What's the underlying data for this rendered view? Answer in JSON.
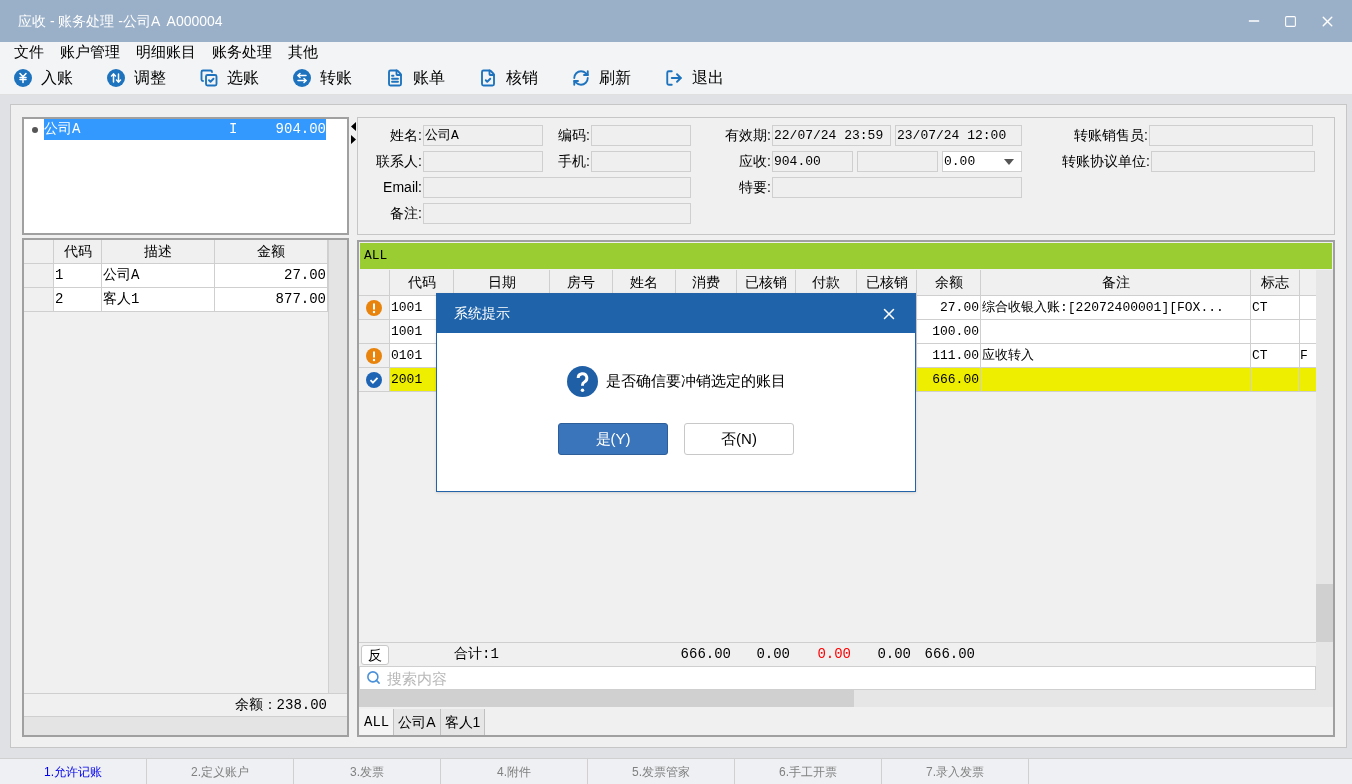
{
  "window": {
    "title": "应收 - 账务处理 -公司A  A000004"
  },
  "menu": [
    "文件",
    "账户管理",
    "明细账目",
    "账务处理",
    "其他"
  ],
  "toolbar": [
    {
      "label": "入账",
      "kind": "yen"
    },
    {
      "label": "调整",
      "kind": "swap-vertical"
    },
    {
      "label": "选账",
      "kind": "select"
    },
    {
      "label": "转账",
      "kind": "transfer"
    },
    {
      "label": "账单",
      "kind": "bill"
    },
    {
      "label": "核销",
      "kind": "verify"
    },
    {
      "label": "刷新",
      "kind": "refresh"
    },
    {
      "label": "退出",
      "kind": "exit"
    }
  ],
  "accounts": [
    {
      "name": "公司A",
      "type": "I",
      "amount": "904.00",
      "selected": true
    }
  ],
  "profile": {
    "name": {
      "label": "姓名:",
      "value": "公司A"
    },
    "code": {
      "label": "编码:"
    },
    "contact": {
      "label": "联系人:"
    },
    "mobile": {
      "label": "手机:"
    },
    "email": {
      "label": "Email:"
    },
    "note": {
      "label": "备注:"
    },
    "validity": {
      "label": "有效期:",
      "from": "22/07/24 23:59",
      "to": "23/07/24 12:00"
    },
    "receivable": {
      "label": "应收:",
      "value": "904.00",
      "rate": "0.00"
    },
    "special": {
      "label": "特要:"
    },
    "salesperson": {
      "label": "转账销售员:"
    },
    "agreement_unit": {
      "label": "转账协议单位:"
    }
  },
  "left_grid": {
    "columns": [
      "代码",
      "描述",
      "金额"
    ],
    "rows": [
      {
        "code": "1",
        "desc": "公司A",
        "amount": "27.00"
      },
      {
        "code": "2",
        "desc": "客人1",
        "amount": "877.00"
      }
    ],
    "balance": "余额：238.00"
  },
  "main_grid": {
    "filter": "ALL",
    "columns": [
      "代码",
      "日期",
      "房号",
      "姓名",
      "消费",
      "已核销",
      "付款",
      "已核销",
      "余额",
      "备注",
      "标志"
    ],
    "rows": [
      {
        "kind": "warning",
        "code": "1001",
        "balance": "27.00",
        "remark": "综合收银入账:[22072400001][FOX...",
        "flag": "CT",
        "selected": false
      },
      {
        "kind": "plain",
        "code": "1001",
        "balance": "100.00",
        "selected": false
      },
      {
        "kind": "warning",
        "code": "0101",
        "balance": "111.00",
        "remark": "应收转入",
        "flag": "CT",
        "column_13": "F",
        "selected": false
      },
      {
        "kind": "checked",
        "code": "2001",
        "balance": "666.00",
        "selected": true
      }
    ],
    "reverse_button": "反",
    "total_label": "合计:1",
    "totals": [
      {
        "value": "666.00",
        "color": "#000000"
      },
      {
        "value": "0.00",
        "color": "#000000"
      },
      {
        "value": "0.00",
        "color": "#ff0000"
      },
      {
        "value": "0.00",
        "color": "#000000"
      },
      {
        "value": "666.00",
        "color": "#000000"
      }
    ],
    "search": {
      "placeholder": "搜索内容"
    },
    "tabs": [
      {
        "label": "ALL",
        "selected": true
      },
      {
        "label": "公司A",
        "selected": false
      },
      {
        "label": "客人1",
        "selected": false
      }
    ]
  },
  "dialog": {
    "title": "系统提示",
    "message": "是否确信要冲销选定的账目",
    "buttons": [
      {
        "label": "是(Y)",
        "selected": true
      },
      {
        "label": "否(N)",
        "selected": false
      }
    ]
  },
  "footer_tabs": [
    {
      "label": "1.允许记账",
      "selected": true
    },
    {
      "label": "2.定义账户",
      "selected": false
    },
    {
      "label": "3.发票",
      "selected": false
    },
    {
      "label": "4.附件",
      "selected": false
    },
    {
      "label": "5.发票管家",
      "selected": false
    },
    {
      "label": "6.手工开票",
      "selected": false
    },
    {
      "label": "7.录入发票",
      "selected": false
    }
  ]
}
